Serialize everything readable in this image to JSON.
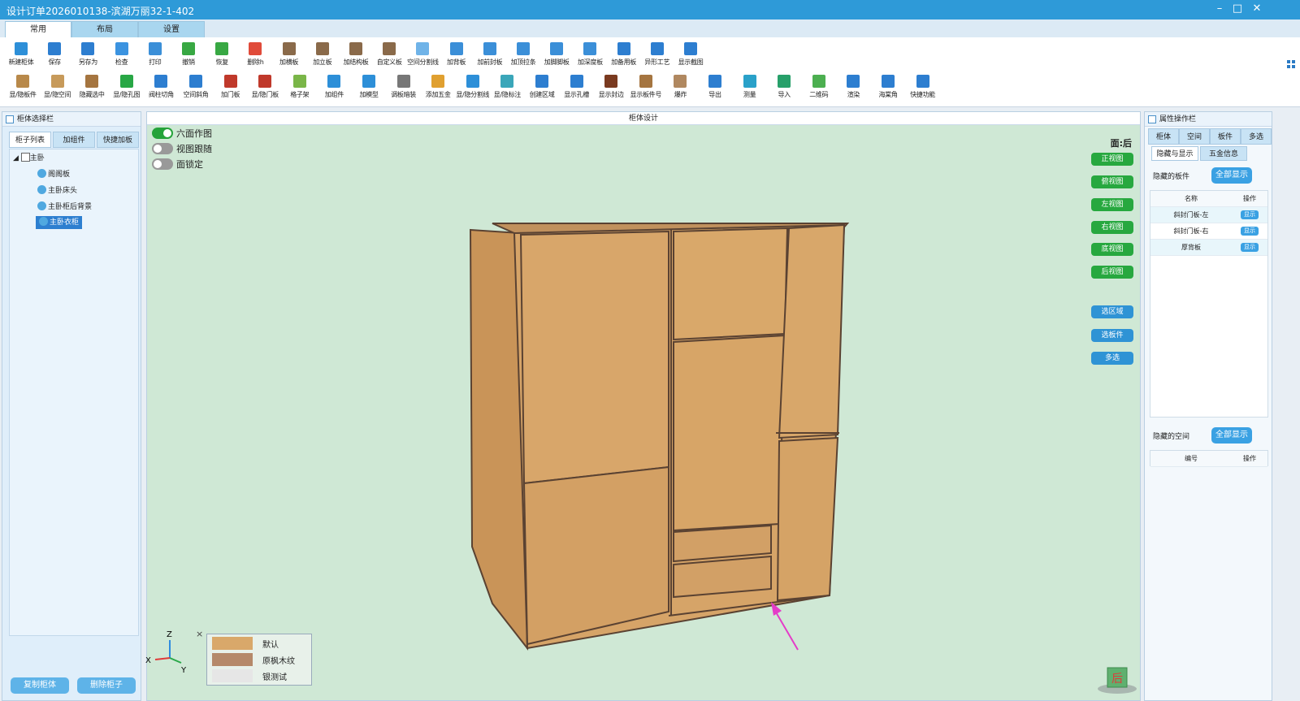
{
  "window": {
    "title": "设计订单2026010138-滨湖万丽32-1-402",
    "minimize": "–",
    "maximize": "□",
    "close": "✕"
  },
  "main_tabs": [
    "常用",
    "布局",
    "设置"
  ],
  "toolbar": {
    "row1": [
      {
        "label": "新建柜体",
        "color": "#2d8fd8"
      },
      {
        "label": "保存",
        "color": "#2d7ed0"
      },
      {
        "label": "另存为",
        "color": "#2d7ed0"
      },
      {
        "label": "检查",
        "color": "#3b93e0"
      },
      {
        "label": "打印",
        "color": "#3b8fd8"
      },
      {
        "label": "撤销",
        "color": "#38a843"
      },
      {
        "label": "恢复",
        "color": "#38a843"
      },
      {
        "label": "删除h",
        "color": "#e04b3a"
      },
      {
        "label": "加横板",
        "color": "#8a6a4a"
      },
      {
        "label": "加立板",
        "color": "#8a6a4a"
      },
      {
        "label": "加结构板",
        "color": "#8a6a4a"
      },
      {
        "label": "自定义板",
        "color": "#8a6a4a"
      },
      {
        "label": "空间分割线",
        "color": "#6fb3e8"
      },
      {
        "label": "加背板",
        "color": "#3b8fd8"
      },
      {
        "label": "加前封板",
        "color": "#3b8fd8"
      },
      {
        "label": "加顶拉条",
        "color": "#3b8fd8"
      },
      {
        "label": "加脚脚板",
        "color": "#3b8fd8"
      },
      {
        "label": "加深度板",
        "color": "#3b8fd8"
      },
      {
        "label": "加备用板",
        "color": "#2d7ed0"
      },
      {
        "label": "异形工艺",
        "color": "#2d7ed0"
      },
      {
        "label": "显示截图",
        "color": "#2d7ed0"
      }
    ],
    "row2": [
      {
        "label": "显/隐板件",
        "color": "#b8894a"
      },
      {
        "label": "显/隐空间",
        "color": "#c79a5a"
      },
      {
        "label": "隐藏选中",
        "color": "#a57540"
      },
      {
        "label": "显/隐孔图",
        "color": "#28a745"
      },
      {
        "label": "阀柱切角",
        "color": "#2d7ed0"
      },
      {
        "label": "空间斜角",
        "color": "#2d7ed0"
      },
      {
        "label": "加门板",
        "color": "#c0392b"
      },
      {
        "label": "显/隐门板",
        "color": "#c0392b"
      },
      {
        "label": "格子架",
        "color": "#7ab648"
      },
      {
        "label": "加组件",
        "color": "#2d8fd8"
      },
      {
        "label": "加模型",
        "color": "#2d8fd8"
      },
      {
        "label": "调板暗装",
        "color": "#777777"
      },
      {
        "label": "添加五金",
        "color": "#e0a030"
      },
      {
        "label": "显/隐分割线",
        "color": "#2d8fd8"
      },
      {
        "label": "显/隐标注",
        "color": "#3aa6b9"
      },
      {
        "label": "创建区域",
        "color": "#2d7ed0"
      },
      {
        "label": "显示孔槽",
        "color": "#2d7ed0"
      },
      {
        "label": "显示封边",
        "color": "#7a3a20"
      },
      {
        "label": "显示板件号",
        "color": "#a57540"
      },
      {
        "label": "爆炸",
        "color": "#b08860"
      },
      {
        "label": "导出",
        "color": "#2d7ed0"
      },
      {
        "label": "测量",
        "color": "#2aa1c9"
      },
      {
        "label": "导入",
        "color": "#27a06a"
      },
      {
        "label": "二维码",
        "color": "#4caf50"
      },
      {
        "label": "渲染",
        "color": "#2d7ed0"
      },
      {
        "label": "海棠角",
        "color": "#2d7ed0"
      },
      {
        "label": "快捷功能",
        "color": "#2d7ed0"
      }
    ]
  },
  "left_panel": {
    "title": "柜体选择栏",
    "tabs": [
      "柜子列表",
      "加组件",
      "快捷加板"
    ],
    "tree": {
      "root": "主卧",
      "items": [
        "阁阁板",
        "主卧床头",
        "主卧柜后背景",
        "主卧衣柜"
      ],
      "selected_index": 3
    },
    "buttons": {
      "copy": "复制柜体",
      "delete": "删除柜子"
    }
  },
  "center": {
    "title": "柜体设计",
    "toggles": [
      {
        "label": "六面作图",
        "on": true
      },
      {
        "label": "视图跟随",
        "on": false
      },
      {
        "label": "面锁定",
        "on": false
      }
    ],
    "face_label": "面:后",
    "view_buttons": [
      "正视图",
      "俯视图",
      "左视图",
      "右视图",
      "底视图",
      "后视图"
    ],
    "select_buttons": [
      "选区域",
      "选板件",
      "多选"
    ],
    "axes": {
      "z": "Z",
      "x": "X",
      "y": "Y"
    },
    "close": "×",
    "materials": [
      {
        "name": "默认",
        "color": "#d9a86a"
      },
      {
        "name": "原枫木纹",
        "color": "#b5896a"
      },
      {
        "name": "银测试",
        "color": "#e6e6e6"
      }
    ],
    "cube_label": "后",
    "wood_color": "#d6a468",
    "edge_color": "#5a4232",
    "background_color": "#cfe8d5"
  },
  "right_panel": {
    "title": "属性操作栏",
    "tabs": [
      "柜体",
      "空间",
      "板件",
      "多选"
    ],
    "subtabs": [
      "隐藏与显示",
      "五金信息"
    ],
    "hidden_boards_label": "隐藏的板件",
    "show_all": "全部显示",
    "boards_header": {
      "name": "名称",
      "op": "操作"
    },
    "boards": [
      {
        "name": "斜封门板-左",
        "op": "显示"
      },
      {
        "name": "斜封门板-右",
        "op": "显示"
      },
      {
        "name": "厚背板",
        "op": "显示"
      }
    ],
    "hidden_spaces_label": "隐藏的空间",
    "spaces_header": {
      "id": "编号",
      "op": "操作"
    }
  }
}
